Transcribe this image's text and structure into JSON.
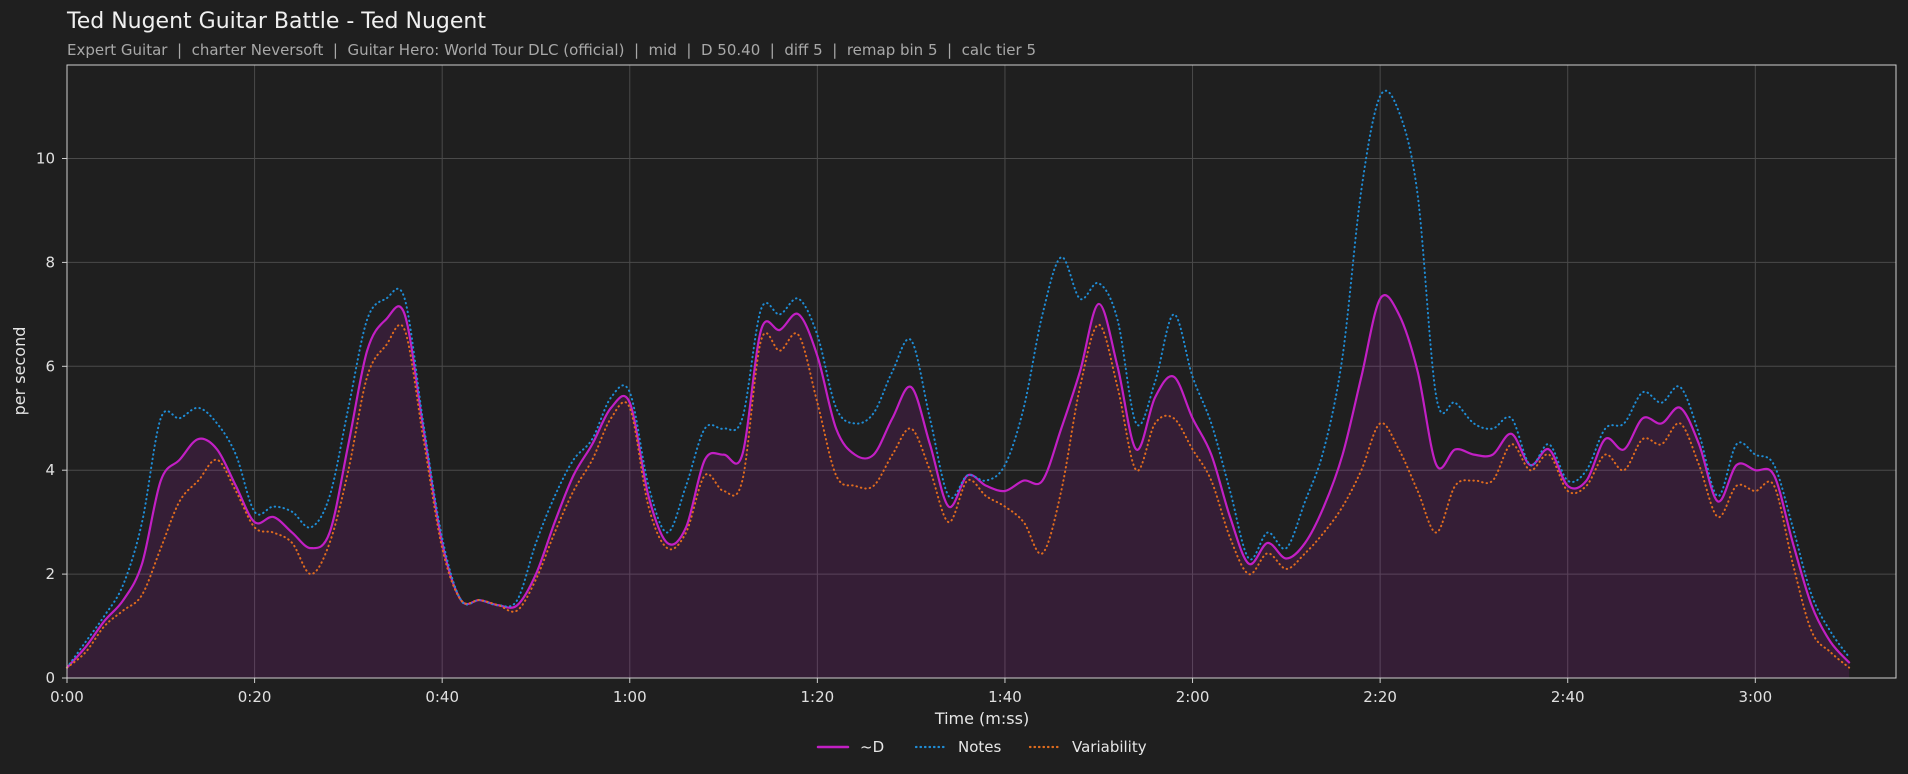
{
  "chart_data": {
    "type": "line",
    "title": "Ted Nugent Guitar Battle - Ted Nugent",
    "subtitle": "Expert Guitar  |  charter Neversoft  |  Guitar Hero: World Tour DLC (official)  |  mid  |  D 50.40  |  diff 5  |  remap bin 5  |  calc tier 5",
    "xlabel": "Time (m:ss)",
    "ylabel": "per second",
    "xlim": [
      0,
      195
    ],
    "ylim": [
      0,
      11.8
    ],
    "grid": true,
    "legend_position": "bottom-center",
    "x_ticks": [
      {
        "value": 0,
        "label": "0:00"
      },
      {
        "value": 20,
        "label": "0:20"
      },
      {
        "value": 40,
        "label": "0:40"
      },
      {
        "value": 60,
        "label": "1:00"
      },
      {
        "value": 80,
        "label": "1:20"
      },
      {
        "value": 100,
        "label": "1:40"
      },
      {
        "value": 120,
        "label": "2:00"
      },
      {
        "value": 140,
        "label": "2:20"
      },
      {
        "value": 160,
        "label": "2:40"
      },
      {
        "value": 180,
        "label": "3:00"
      }
    ],
    "y_ticks": [
      {
        "value": 0,
        "label": "0"
      },
      {
        "value": 2,
        "label": "2"
      },
      {
        "value": 4,
        "label": "4"
      },
      {
        "value": 6,
        "label": "6"
      },
      {
        "value": 8,
        "label": "8"
      },
      {
        "value": 10,
        "label": "10"
      }
    ],
    "x": [
      0,
      2,
      4,
      6,
      8,
      10,
      12,
      14,
      16,
      18,
      20,
      22,
      24,
      26,
      28,
      30,
      32,
      34,
      36,
      38,
      40,
      42,
      44,
      46,
      48,
      50,
      52,
      54,
      56,
      58,
      60,
      62,
      64,
      66,
      68,
      70,
      72,
      74,
      76,
      78,
      80,
      82,
      84,
      86,
      88,
      90,
      92,
      94,
      96,
      98,
      100,
      102,
      104,
      106,
      108,
      110,
      112,
      114,
      116,
      118,
      120,
      122,
      124,
      126,
      128,
      130,
      132,
      134,
      136,
      138,
      140,
      142,
      144,
      146,
      148,
      150,
      152,
      154,
      156,
      158,
      160,
      162,
      164,
      166,
      168,
      170,
      172,
      174,
      176,
      178,
      180,
      182,
      184,
      186,
      188,
      190,
      192,
      194,
      195
    ],
    "series": [
      {
        "name": "~D",
        "color": "#c21fc4",
        "style": "solid",
        "values": [
          0.2,
          0.6,
          1.1,
          1.5,
          2.2,
          3.8,
          4.2,
          4.6,
          4.4,
          3.7,
          3.0,
          3.1,
          2.8,
          2.5,
          2.8,
          4.5,
          6.3,
          6.9,
          7.0,
          4.8,
          2.6,
          1.5,
          1.5,
          1.4,
          1.4,
          2.0,
          3.0,
          3.9,
          4.5,
          5.2,
          5.3,
          3.5,
          2.6,
          2.9,
          4.2,
          4.3,
          4.3,
          6.7,
          6.7,
          7.0,
          6.2,
          4.8,
          4.3,
          4.3,
          5.0,
          5.6,
          4.5,
          3.3,
          3.9,
          3.7,
          3.6,
          3.8,
          3.8,
          4.8,
          5.9,
          7.2,
          6.0,
          4.4,
          5.4,
          5.8,
          5.0,
          4.3,
          3.1,
          2.2,
          2.6,
          2.3,
          2.6,
          3.3,
          4.3,
          5.8,
          7.3,
          7.0,
          5.9,
          4.1,
          4.4,
          4.3,
          4.3,
          4.7,
          4.1,
          4.4,
          3.7,
          3.8,
          4.6,
          4.4,
          5.0,
          4.9,
          5.2,
          4.5,
          3.4,
          4.1,
          4.0,
          3.9,
          2.6,
          1.4,
          0.7,
          0.3
        ]
      },
      {
        "name": "Notes",
        "color": "#1f8dd6",
        "style": "dotted",
        "values": [
          0.2,
          0.7,
          1.2,
          1.8,
          3.0,
          5.0,
          5.0,
          5.2,
          4.9,
          4.3,
          3.2,
          3.3,
          3.2,
          2.9,
          3.5,
          5.2,
          6.9,
          7.3,
          7.3,
          4.9,
          2.7,
          1.5,
          1.5,
          1.4,
          1.5,
          2.6,
          3.5,
          4.2,
          4.6,
          5.4,
          5.5,
          3.7,
          2.8,
          3.7,
          4.8,
          4.8,
          5.0,
          7.1,
          7.0,
          7.3,
          6.6,
          5.2,
          4.9,
          5.1,
          5.9,
          6.5,
          5.0,
          3.5,
          3.9,
          3.8,
          4.1,
          5.2,
          7.0,
          8.1,
          7.3,
          7.6,
          6.9,
          4.9,
          5.7,
          7.0,
          5.8,
          4.9,
          3.6,
          2.3,
          2.8,
          2.5,
          3.4,
          4.4,
          6.2,
          9.4,
          11.2,
          10.9,
          9.3,
          5.4,
          5.3,
          4.9,
          4.8,
          5.0,
          4.1,
          4.5,
          3.8,
          4.0,
          4.8,
          4.9,
          5.5,
          5.3,
          5.6,
          4.7,
          3.5,
          4.5,
          4.3,
          4.1,
          2.9,
          1.6,
          0.9,
          0.4
        ]
      },
      {
        "name": "Variability",
        "color": "#e06c1e",
        "style": "dotted",
        "values": [
          0.2,
          0.5,
          1.0,
          1.3,
          1.6,
          2.5,
          3.4,
          3.8,
          4.2,
          3.6,
          2.9,
          2.8,
          2.6,
          2.0,
          2.6,
          4.0,
          5.8,
          6.4,
          6.7,
          4.6,
          2.5,
          1.5,
          1.5,
          1.4,
          1.3,
          1.9,
          2.8,
          3.6,
          4.2,
          5.0,
          5.2,
          3.3,
          2.5,
          2.8,
          3.9,
          3.6,
          3.8,
          6.5,
          6.3,
          6.6,
          5.3,
          3.9,
          3.7,
          3.7,
          4.3,
          4.8,
          4.0,
          3.0,
          3.8,
          3.5,
          3.3,
          3.0,
          2.4,
          3.6,
          5.6,
          6.8,
          5.6,
          4.0,
          4.9,
          5.0,
          4.4,
          3.8,
          2.7,
          2.0,
          2.4,
          2.1,
          2.4,
          2.8,
          3.3,
          4.0,
          4.9,
          4.4,
          3.6,
          2.8,
          3.7,
          3.8,
          3.8,
          4.5,
          4.0,
          4.3,
          3.6,
          3.7,
          4.3,
          4.0,
          4.6,
          4.5,
          4.9,
          4.1,
          3.1,
          3.7,
          3.6,
          3.7,
          2.2,
          0.9,
          0.5,
          0.2
        ]
      }
    ]
  }
}
